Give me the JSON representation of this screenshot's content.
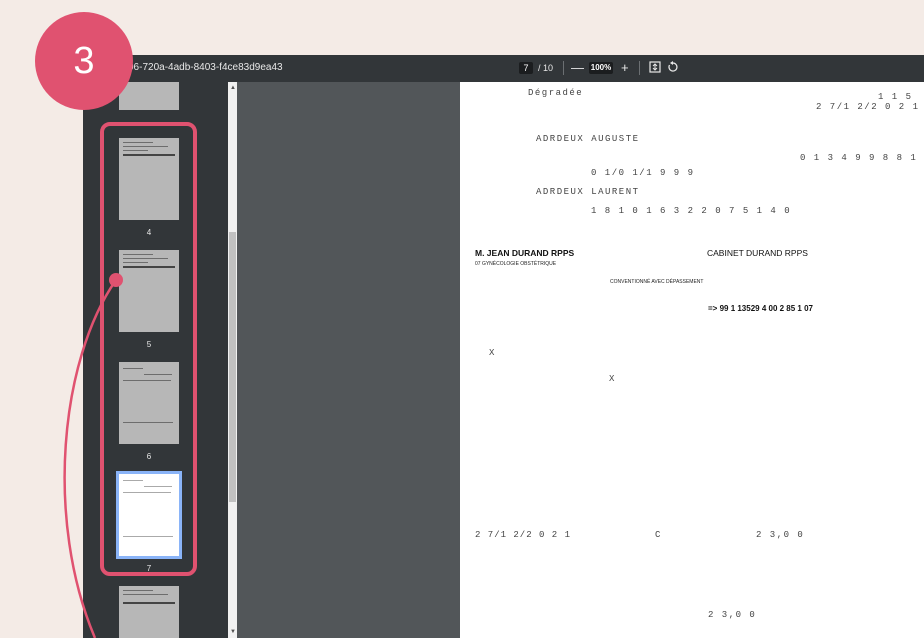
{
  "step": {
    "number": "3"
  },
  "toolbar": {
    "doc_title": "06-720a-4adb-8403-f4ce83d9ea43",
    "page_current": "7",
    "page_total": "/ 10",
    "zoom_out": "—",
    "zoom_value": "100%",
    "zoom_in": "+",
    "fit_icon": "fit-page-icon",
    "rotate_icon": "rotate-icon"
  },
  "sidebar": {
    "thumbnails": [
      {
        "number": "4"
      },
      {
        "number": "5"
      },
      {
        "number": "6"
      },
      {
        "number": "7",
        "selected": true
      }
    ]
  },
  "page": {
    "l1": "Dégradée",
    "l2": "1 1 5",
    "l3": "2 7/1 2/2 0 2 1",
    "l4": "ADRDEUX AUGUSTE",
    "l5": "0 1 3 4 9 9 8 8 1",
    "l6": "0 1/0 1/1 9 9 9",
    "l7": "ADRDEUX LAURENT",
    "l8": "1 8 1 0 1 6 3 2 2 0 7 5 1  4 0",
    "doctor": "M. JEAN DURAND RPPS",
    "cabinet": "CABINET DURAND RPPS",
    "specialty": "07 GYNÉCOLOGIE OBSTÉTRIQUE",
    "convention": "CONVENTIONNÉ AVEC DÉPASSEMENT",
    "code": "=>  99 1 13529 4  00 2 85 1 07",
    "x1": "X",
    "x2": "X",
    "date2": "2 7/1 2/2 0 2 1",
    "c": "C",
    "amount1": "2 3,0 0",
    "amount2": "2 3,0 0"
  },
  "colors": {
    "accent": "#e05270",
    "selection": "#8ab4f8"
  }
}
